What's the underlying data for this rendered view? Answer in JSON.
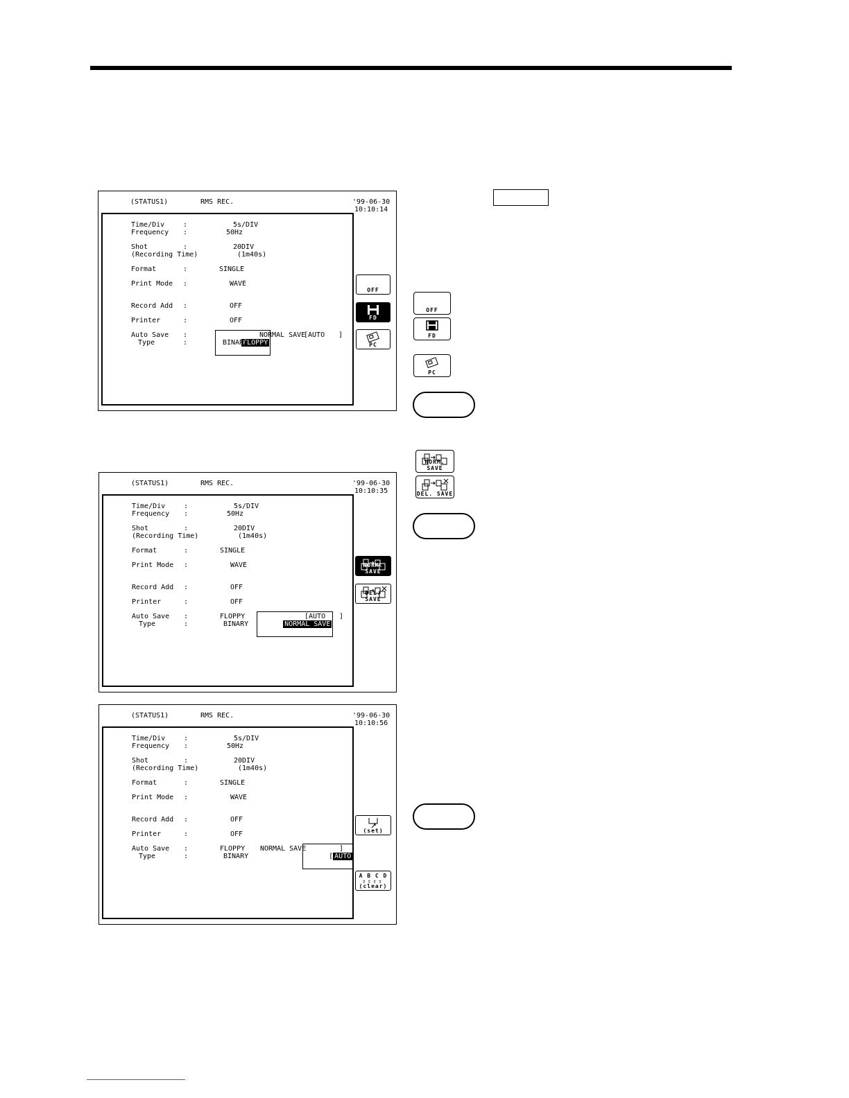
{
  "screens": [
    {
      "header": {
        "status": "(STATUS1)",
        "mode": "RMS REC.",
        "date": "'99-06-30",
        "time": "10:10:14"
      },
      "rows": {
        "timediv": {
          "label": "Time/Div",
          "colon": ":",
          "value": "5s/DIV"
        },
        "frequency": {
          "label": "Frequency",
          "colon": ":",
          "value": "50Hz"
        },
        "shot": {
          "label": "Shot",
          "colon": ":",
          "value": "20DIV"
        },
        "rectime": {
          "label": "(Recording Time)",
          "value": "(1m40s)"
        },
        "format": {
          "label": "Format",
          "colon": ":",
          "value": "SINGLE"
        },
        "printmode": {
          "label": "Print Mode",
          "colon": ":",
          "value": "WAVE"
        },
        "recordadd": {
          "label": "Record Add",
          "colon": ":",
          "value": "OFF"
        },
        "printer": {
          "label": "Printer",
          "colon": ":",
          "value": "OFF"
        },
        "autosave": {
          "label": "Auto Save",
          "colon": ":",
          "value": "FLOPPY",
          "mode": "NORMAL SAVE",
          "auto": "[AUTO",
          "close": "]"
        },
        "type": {
          "label": "Type",
          "colon": ":",
          "value": "BINARY"
        }
      },
      "softkeys": [
        {
          "label": "OFF"
        },
        {
          "label": "FD"
        },
        {
          "label": "PC"
        }
      ]
    },
    {
      "header": {
        "status": "(STATUS1)",
        "mode": "RMS REC.",
        "date": "'99-06-30",
        "time": "10:10:35"
      },
      "rows": {
        "timediv": {
          "label": "Time/Div",
          "colon": ":",
          "value": "5s/DIV"
        },
        "frequency": {
          "label": "Frequency",
          "colon": ":",
          "value": "50Hz"
        },
        "shot": {
          "label": "Shot",
          "colon": ":",
          "value": "20DIV"
        },
        "rectime": {
          "label": "(Recording Time)",
          "value": "(1m40s)"
        },
        "format": {
          "label": "Format",
          "colon": ":",
          "value": "SINGLE"
        },
        "printmode": {
          "label": "Print Mode",
          "colon": ":",
          "value": "WAVE"
        },
        "recordadd": {
          "label": "Record Add",
          "colon": ":",
          "value": "OFF"
        },
        "printer": {
          "label": "Printer",
          "colon": ":",
          "value": "OFF"
        },
        "autosave": {
          "label": "Auto Save",
          "colon": ":",
          "value": "FLOPPY",
          "mode": "NORMAL SAVE",
          "auto": "[AUTO",
          "close": "]"
        },
        "type": {
          "label": "Type",
          "colon": ":",
          "value": "BINARY"
        }
      },
      "softkeys": [
        {
          "label": "NORM. SAVE"
        },
        {
          "label": "DEL. SAVE"
        }
      ]
    },
    {
      "header": {
        "status": "(STATUS1)",
        "mode": "RMS REC.",
        "date": "'99-06-30",
        "time": "10:10:56"
      },
      "rows": {
        "timediv": {
          "label": "Time/Div",
          "colon": ":",
          "value": "5s/DIV"
        },
        "frequency": {
          "label": "Frequency",
          "colon": ":",
          "value": "50Hz"
        },
        "shot": {
          "label": "Shot",
          "colon": ":",
          "value": "20DIV"
        },
        "rectime": {
          "label": "(Recording Time)",
          "value": "(1m40s)"
        },
        "format": {
          "label": "Format",
          "colon": ":",
          "value": "SINGLE"
        },
        "printmode": {
          "label": "Print Mode",
          "colon": ":",
          "value": "WAVE"
        },
        "recordadd": {
          "label": "Record Add",
          "colon": ":",
          "value": "OFF"
        },
        "printer": {
          "label": "Printer",
          "colon": ":",
          "value": "OFF"
        },
        "autosave": {
          "label": "Auto Save",
          "colon": ":",
          "value": "FLOPPY",
          "mode": "NORMAL SAVE",
          "auto": "AUTO",
          "open": "[",
          "close": "]"
        },
        "type": {
          "label": "Type",
          "colon": ":",
          "value": "BINARY"
        }
      },
      "softkeys": [
        {
          "label": "(set)"
        },
        {
          "label": "A B C D",
          "sub": "(clear)"
        }
      ]
    }
  ],
  "side_icons": [
    {
      "name": "off",
      "label": "OFF"
    },
    {
      "name": "fd",
      "label": "FD"
    },
    {
      "name": "pc",
      "label": "PC"
    },
    {
      "name": "norm-save",
      "label": "NORM. SAVE"
    },
    {
      "name": "del-save",
      "label": "DEL. SAVE"
    }
  ]
}
